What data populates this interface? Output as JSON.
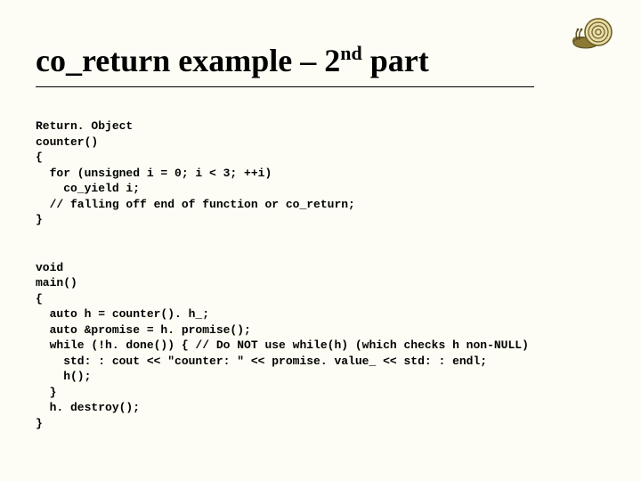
{
  "title_pre": "co_return example – 2",
  "title_sup": "nd",
  "title_post": " part",
  "icon_name": "snail-icon",
  "code1_line1": "Return. Object",
  "code1_line2": "counter()",
  "code1_line3": "{",
  "code1_line4": "  for (unsigned i = 0; i < 3; ++i)",
  "code1_line5": "    co_yield i;",
  "code1_line6": "  // falling off end of function or co_return;",
  "code1_line7": "}",
  "code2_line1": "void",
  "code2_line2": "main()",
  "code2_line3": "{",
  "code2_line4": "  auto h = counter(). h_;",
  "code2_line5": "  auto &promise = h. promise();",
  "code2_line6": "  while (!h. done()) { // Do NOT use while(h) (which checks h non-NULL)",
  "code2_line7": "    std: : cout << \"counter: \" << promise. value_ << std: : endl;",
  "code2_line8": "    h();",
  "code2_line9": "  }",
  "code2_line10": "  h. destroy();",
  "code2_line11": "}"
}
